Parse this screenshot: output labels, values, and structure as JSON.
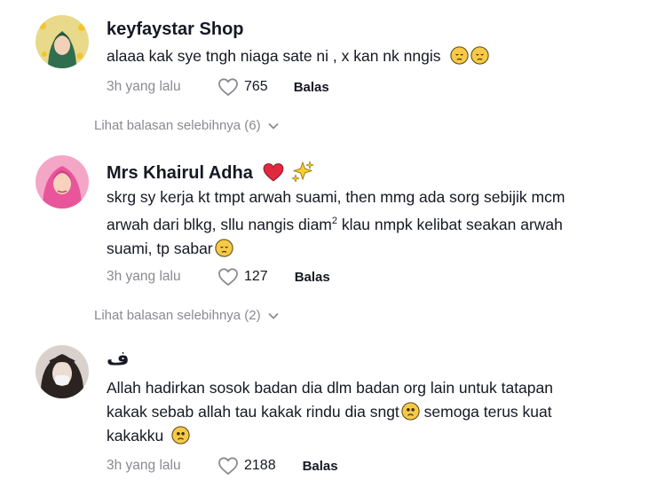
{
  "comments": [
    {
      "username": "keyfaystar Shop",
      "text": "alaaa kak sye tngh niaga sate ni , x kan nk nngis",
      "time": "3h yang lalu",
      "likes": "765",
      "reply_label": "Balas",
      "more_replies": "Lihat balasan selebihnya (6)"
    },
    {
      "username": "Mrs Khairul Adha",
      "text_line1": "skrg sy kerja kt tmpt arwah suami, then mmg ada sorg sebijik mcm",
      "text_line2a": "arwah dari blkg, sllu nangis diam",
      "text_sup": "2",
      "text_line2b": " klau nmpk kelibat seakan arwah",
      "text_line3": "suami, tp sabar",
      "time": "3h yang lalu",
      "likes": "127",
      "reply_label": "Balas",
      "more_replies": "Lihat balasan selebihnya (2)"
    },
    {
      "username": "ف",
      "text_line1": "Allah hadirkan sosok badan dia dlm badan org lain untuk tatapan",
      "text_line2": "kakak sebab allah tau kakak rindu dia sngt",
      "text_line2b": " semoga terus kuat",
      "text_line3": "kakakku ",
      "time": "3h yang lalu",
      "likes": "2188",
      "reply_label": "Balas"
    }
  ],
  "colors": {
    "text": "#161823",
    "secondary": "#8a8b91",
    "emoji_face": "#f7c948",
    "heart_red": "#e0283f"
  },
  "icons": [
    "heart-outline-icon",
    "chevron-down-icon",
    "sad-face-emoji",
    "red-heart-emoji",
    "sparkles-emoji"
  ]
}
